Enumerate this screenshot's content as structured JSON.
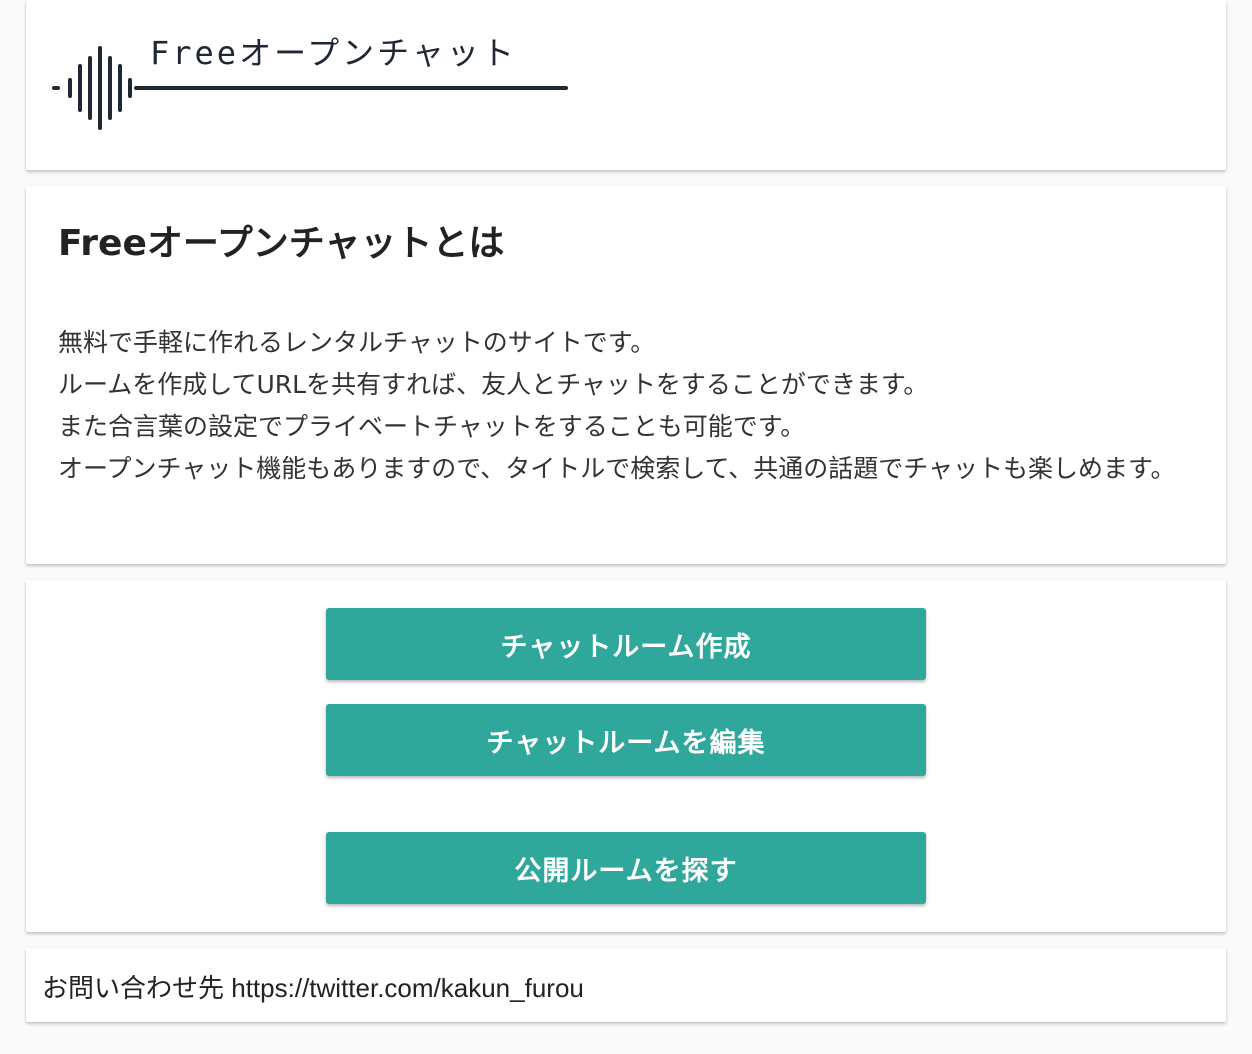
{
  "logo": {
    "text": "Freeオープンチャット"
  },
  "about": {
    "title": "Freeオープンチャットとは",
    "lines": [
      "無料で手軽に作れるレンタルチャットのサイトです。",
      "ルームを作成してURLを共有すれば、友人とチャットをすることができます。",
      "また合言葉の設定でプライベートチャットをすることも可能です。",
      "オープンチャット機能もありますので、タイトルで検索して、共通の話題でチャットも楽しめます。"
    ]
  },
  "actions": {
    "create_label": "チャットルーム作成",
    "edit_label": "チャットルームを編集",
    "search_label": "公開ルームを探す"
  },
  "contact": {
    "label": "お問い合わせ先",
    "url": "https://twitter.com/kakun_furou"
  },
  "colors": {
    "accent": "#2fa79a",
    "logo": "#1f2733",
    "background": "#fafafa"
  }
}
